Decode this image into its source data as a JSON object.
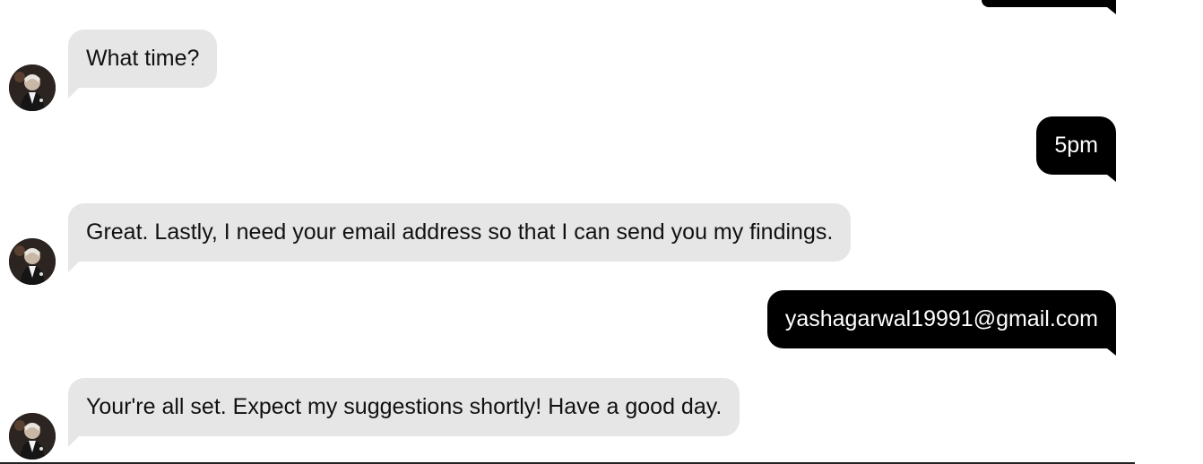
{
  "messages": [
    {
      "sender": "bot",
      "text": "What time?"
    },
    {
      "sender": "user",
      "text": "5pm"
    },
    {
      "sender": "bot",
      "text": "Great. Lastly, I need your email address so that I can send you my findings."
    },
    {
      "sender": "user",
      "text": "yashagarwal19991@gmail.com"
    },
    {
      "sender": "bot",
      "text": "Your're all set. Expect my suggestions shortly! Have a good day."
    }
  ],
  "colors": {
    "bot_bubble": "#e6e6e6",
    "user_bubble": "#000000",
    "bot_text": "#111111",
    "user_text": "#ffffff"
  },
  "icons": {
    "bot_avatar": "bot-avatar-photo"
  }
}
